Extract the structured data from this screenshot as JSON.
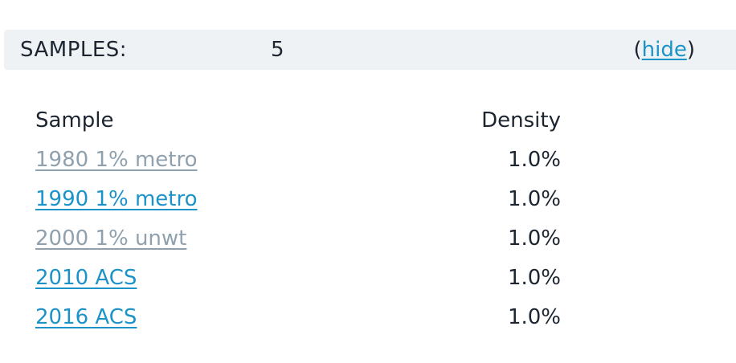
{
  "header": {
    "label": "SAMPLES:",
    "count": "5",
    "toggle_open": "(",
    "toggle_label": "hide",
    "toggle_close": ")"
  },
  "table": {
    "columns": [
      "Sample",
      "Density"
    ],
    "rows": [
      {
        "sample": "1980 1% metro",
        "density": "1.0%",
        "style": "muted"
      },
      {
        "sample": "1990 1% metro",
        "density": "1.0%",
        "style": "active"
      },
      {
        "sample": "2000 1% unwt",
        "density": "1.0%",
        "style": "muted"
      },
      {
        "sample": "2010 ACS",
        "density": "1.0%",
        "style": "active"
      },
      {
        "sample": "2016 ACS",
        "density": "1.0%",
        "style": "active"
      }
    ]
  },
  "colors": {
    "link_active": "#1b93c9",
    "link_muted": "#8fa1ae",
    "header_bg": "#eff2f5"
  }
}
